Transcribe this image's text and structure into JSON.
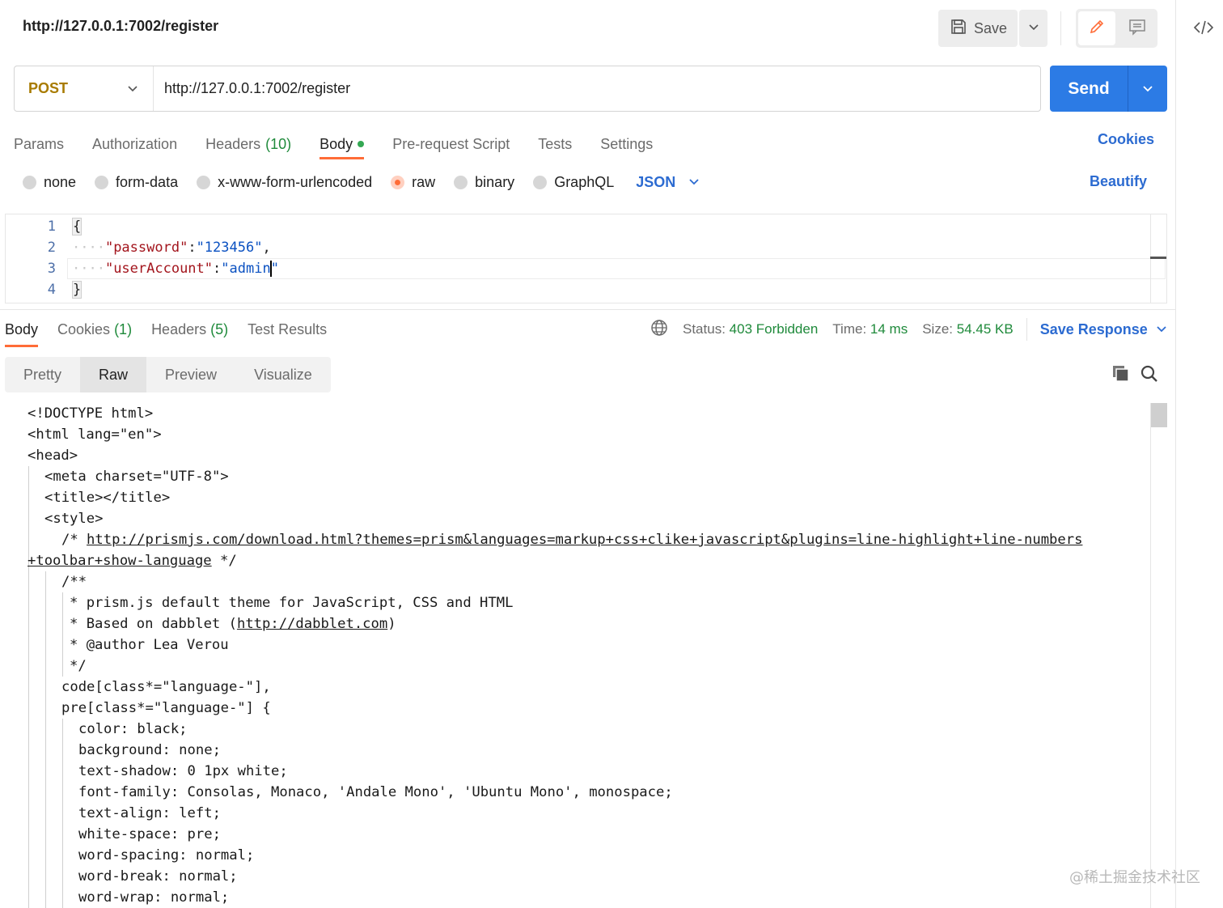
{
  "request": {
    "title": "http://127.0.0.1:7002/register",
    "method": "POST",
    "url": "http://127.0.0.1:7002/register",
    "save_label": "Save",
    "send_label": "Send",
    "cookies_label": "Cookies",
    "beautify_label": "Beautify"
  },
  "request_tabs": [
    {
      "label": "Params"
    },
    {
      "label": "Authorization"
    },
    {
      "label": "Headers",
      "count": "(10)"
    },
    {
      "label": "Body"
    },
    {
      "label": "Pre-request Script"
    },
    {
      "label": "Tests"
    },
    {
      "label": "Settings"
    }
  ],
  "body_types": {
    "none": "none",
    "form_data": "form-data",
    "urlencoded": "x-www-form-urlencoded",
    "raw": "raw",
    "binary": "binary",
    "graphql": "GraphQL",
    "format": "JSON"
  },
  "request_body": {
    "line_numbers": [
      "1",
      "2",
      "3",
      "4"
    ],
    "open_brace": "{",
    "close_brace": "}",
    "password_key": "\"password\"",
    "password_value": "\"123456\"",
    "account_key": "\"userAccount\"",
    "account_value_before_cursor": "\"admin",
    "account_value_after_cursor": "\""
  },
  "response_tabs": [
    {
      "label": "Body"
    },
    {
      "label": "Cookies",
      "count": "(1)"
    },
    {
      "label": "Headers",
      "count": "(5)"
    },
    {
      "label": "Test Results"
    }
  ],
  "response_meta": {
    "status_label": "Status:",
    "status_value": "403 Forbidden",
    "time_label": "Time:",
    "time_value": "14 ms",
    "size_label": "Size:",
    "size_value": "54.45 KB",
    "save_response_label": "Save Response"
  },
  "view_modes": [
    "Pretty",
    "Raw",
    "Preview",
    "Visualize"
  ],
  "response_body": {
    "l1": "<!DOCTYPE html>",
    "l2": "<html lang=\"en\">",
    "l3": "<head>",
    "l4": "<meta charset=\"UTF-8\">",
    "l5": "<title></title>",
    "l6": "<style>",
    "l7_prefix": "/* ",
    "l7_link": "http://prismjs.com/download.html?themes=prism&languages=markup+css+clike+javascript&plugins=line-highlight+line-numbers",
    "l8_link": "+toolbar+show-language",
    "l8_suffix": " */",
    "l9": "/**",
    "l10": "* prism.js default theme for JavaScript, CSS and HTML",
    "l11_prefix": "* Based on dabblet (",
    "l11_link": "http://dabblet.com",
    "l11_suffix": ")",
    "l12": "* @author Lea Verou",
    "l13": "*/",
    "l14": "code[class*=\"language-\"],",
    "l15": "pre[class*=\"language-\"] {",
    "l16": "color: black;",
    "l17": "background: none;",
    "l18": "text-shadow: 0 1px white;",
    "l19": "font-family: Consolas, Monaco, 'Andale Mono', 'Ubuntu Mono', monospace;",
    "l20": "text-align: left;",
    "l21": "white-space: pre;",
    "l22": "word-spacing: normal;",
    "l23": "word-break: normal;",
    "l24": "word-wrap: normal;"
  },
  "watermark": "@稀土掘金技术社区",
  "colors": {
    "accent": "#ff6c37",
    "send_button": "#2c7be5",
    "link": "#2c6bd1",
    "method_post": "#a87b00",
    "status_ok_green": "#1f8a3b"
  }
}
